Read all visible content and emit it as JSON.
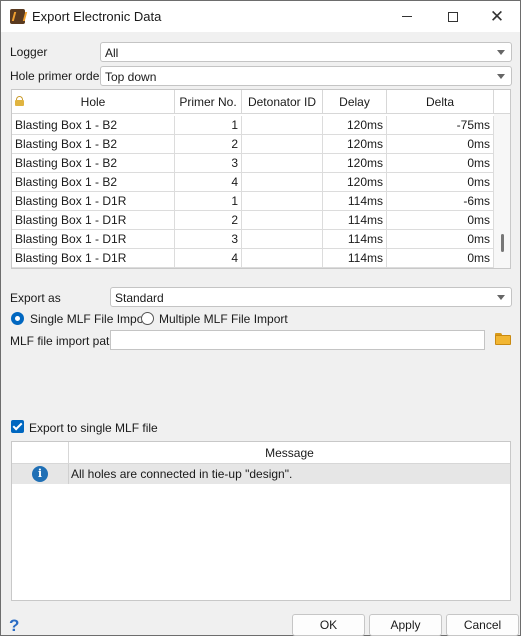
{
  "window": {
    "title": "Export Electronic Data"
  },
  "logger": {
    "label": "Logger",
    "value": "All"
  },
  "hole_primer_order": {
    "label": "Hole primer order",
    "value": "Top down"
  },
  "grid": {
    "columns": [
      "Hole",
      "Primer No.",
      "Detonator ID",
      "Delay",
      "Delta"
    ],
    "rows": [
      [
        "Blasting Box 1 - B2",
        "1",
        "",
        "120ms",
        "-75ms"
      ],
      [
        "Blasting Box 1 - B2",
        "2",
        "",
        "120ms",
        "0ms"
      ],
      [
        "Blasting Box 1 - B2",
        "3",
        "",
        "120ms",
        "0ms"
      ],
      [
        "Blasting Box 1 - B2",
        "4",
        "",
        "120ms",
        "0ms"
      ],
      [
        "Blasting Box 1 - D1R",
        "1",
        "",
        "114ms",
        "-6ms"
      ],
      [
        "Blasting Box 1 - D1R",
        "2",
        "",
        "114ms",
        "0ms"
      ],
      [
        "Blasting Box 1 - D1R",
        "3",
        "",
        "114ms",
        "0ms"
      ],
      [
        "Blasting Box 1 - D1R",
        "4",
        "",
        "114ms",
        "0ms"
      ]
    ]
  },
  "export_as": {
    "label": "Export as",
    "value": "Standard"
  },
  "import_mode": {
    "single": "Single MLF File Import",
    "multiple": "Multiple MLF File Import",
    "selected": "single"
  },
  "mlf_path": {
    "label": "MLF file import path",
    "value": ""
  },
  "export_single": {
    "label": "Export to single MLF file",
    "checked": true
  },
  "messages": {
    "header": "Message",
    "rows": [
      {
        "icon": "info-icon",
        "text": "All holes are connected in tie-up \"design\"."
      }
    ]
  },
  "buttons": {
    "ok": "OK",
    "apply": "Apply",
    "cancel": "Cancel"
  },
  "colors": {
    "accent": "#0067c0",
    "folder": "#f2b632"
  }
}
